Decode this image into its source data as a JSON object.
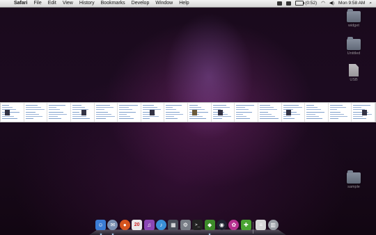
{
  "menubar": {
    "apple_icon": "apple-icon",
    "items": [
      "Safari",
      "File",
      "Edit",
      "View",
      "History",
      "Bookmarks",
      "Develop",
      "Window",
      "Help"
    ],
    "status": {
      "battery_time": "(0:52)",
      "clock": "Mon 9:58 AM"
    }
  },
  "desktop": {
    "icons": [
      {
        "type": "folder",
        "label": "widget"
      },
      {
        "type": "folder",
        "label": "Untitled"
      },
      {
        "type": "document",
        "label": "USB"
      },
      {
        "type": "folder",
        "label": "sample"
      }
    ]
  },
  "thumb_strip": {
    "count": 16
  },
  "dock": {
    "apps": [
      {
        "name": "finder-icon",
        "color": "#3b7bd4",
        "glyph": "☺",
        "running": true
      },
      {
        "name": "mail-icon",
        "color": "#7a8fb0",
        "glyph": "✉",
        "running": true
      },
      {
        "name": "firefox-icon",
        "color": "#d4541e",
        "glyph": "●",
        "running": false
      },
      {
        "name": "calendar-icon",
        "color": "#e9e9e9",
        "glyph": "20",
        "running": false
      },
      {
        "name": "itunes-icon",
        "color": "#8b46b5",
        "glyph": "♫",
        "running": false
      },
      {
        "name": "itunes-store-icon",
        "color": "#3a90d6",
        "glyph": "♪",
        "running": false
      },
      {
        "name": "photo-icon",
        "color": "#4a4f5a",
        "glyph": "▦",
        "running": false
      },
      {
        "name": "system-preferences-icon",
        "color": "#777c85",
        "glyph": "⚙",
        "running": false
      },
      {
        "name": "terminal-icon",
        "color": "#222222",
        "glyph": ">_",
        "running": false
      },
      {
        "name": "android-icon",
        "color": "#3d8a2a",
        "glyph": "◆",
        "running": true
      },
      {
        "name": "front-row-icon",
        "color": "#1e2230",
        "glyph": "◉",
        "running": false
      },
      {
        "name": "pink-app-icon",
        "color": "#b5308e",
        "glyph": "✿",
        "running": false
      },
      {
        "name": "green-app-icon",
        "color": "#4aa332",
        "glyph": "✚",
        "running": false
      },
      {
        "name": "documents-stack-icon",
        "color": "#d8d8d8",
        "glyph": "≡",
        "running": false
      },
      {
        "name": "trash-icon",
        "color": "#9a9ea5",
        "glyph": "▥",
        "running": false
      }
    ]
  }
}
